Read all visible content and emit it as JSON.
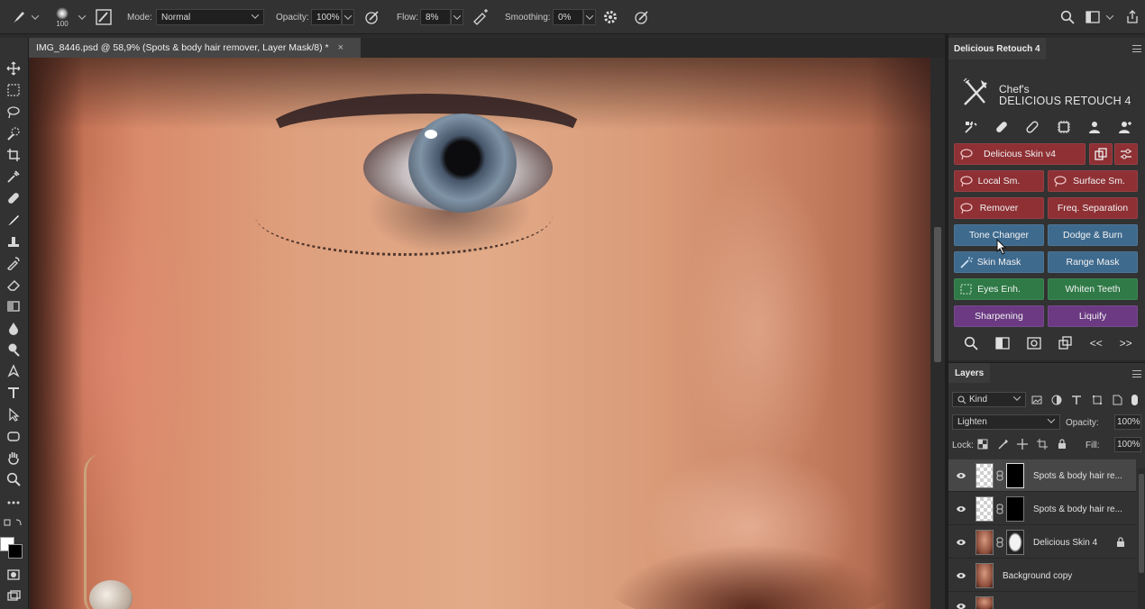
{
  "options_bar": {
    "brush_size": "100",
    "mode_label": "Mode:",
    "mode_value": "Normal",
    "opacity_label": "Opacity:",
    "opacity_value": "100%",
    "flow_label": "Flow:",
    "flow_value": "8%",
    "smoothing_label": "Smoothing:",
    "smoothing_value": "0%"
  },
  "document": {
    "tab_title": "IMG_8446.psd @ 58,9% (Spots & body hair remover, Layer Mask/8) *",
    "close_glyph": "×"
  },
  "plugin": {
    "panel_title": "Delicious Retouch 4",
    "brand_line1": "Chef's",
    "brand_line2": "DELICIOUS RETOUCH 4",
    "buttons": {
      "skin_v4": "Delicious Skin v4",
      "local_sm": "Local Sm.",
      "surface_sm": "Surface Sm.",
      "remover": "Remover",
      "freq_sep": "Freq. Separation",
      "tone_changer": "Tone Changer",
      "dodge_burn": "Dodge & Burn",
      "skin_mask": "Skin Mask",
      "range_mask": "Range Mask",
      "eyes_enh": "Eyes Enh.",
      "whiten_teeth": "Whiten Teeth",
      "sharpening": "Sharpening",
      "liquify": "Liquify"
    },
    "nav_prev": "<<",
    "nav_next": ">>"
  },
  "layers": {
    "panel_title": "Layers",
    "filter_kind": "Kind",
    "blend_mode": "Lighten",
    "opacity_label": "Opacity:",
    "opacity_value": "100%",
    "lock_label": "Lock:",
    "fill_label": "Fill:",
    "fill_value": "100%",
    "items": [
      {
        "name": "Spots & body hair re..."
      },
      {
        "name": "Spots & body hair re..."
      },
      {
        "name": "Delicious Skin 4"
      },
      {
        "name": "Background copy"
      }
    ]
  },
  "colors": {
    "button_red": "#8e3034",
    "button_blue": "#3e6a8e",
    "button_green": "#2f7a46",
    "button_purple": "#6b3a82"
  }
}
